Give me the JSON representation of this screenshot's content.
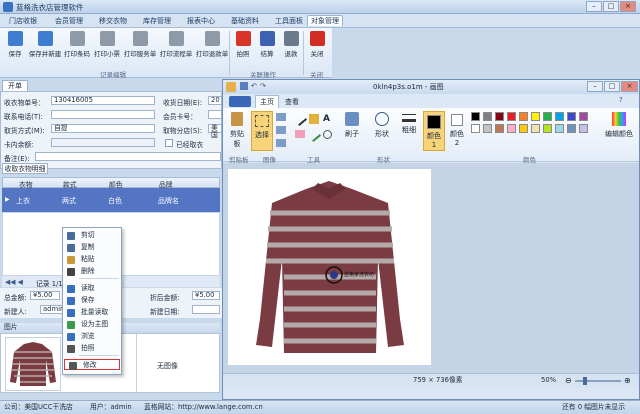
{
  "app": {
    "title": "蓝格洗衣店管理软件"
  },
  "menu": [
    "门店收银",
    "会员管理",
    "移交衣物",
    "库存管理",
    "报表中心",
    "基础资料",
    "工具面板",
    "对象管理"
  ],
  "ribbon": {
    "buttons": [
      {
        "label": "保存",
        "icon": "save-icon",
        "color": "#3f7dd0"
      },
      {
        "label": "保存并新建",
        "icon": "save-new-icon",
        "color": "#3f7dd0"
      },
      {
        "label": "打印条码",
        "icon": "printer-icon",
        "color": "#8e9aa8"
      },
      {
        "label": "打印小票",
        "icon": "printer-icon",
        "color": "#8e9aa8"
      },
      {
        "label": "打印服务单",
        "icon": "printer-icon",
        "color": "#8e9aa8"
      },
      {
        "label": "打印流程单",
        "icon": "printer-icon",
        "color": "#8e9aa8"
      },
      {
        "label": "打印退款单",
        "icon": "printer-icon",
        "color": "#8e9aa8"
      },
      {
        "label": "拍照",
        "icon": "eye-icon",
        "color": "#d8342a"
      },
      {
        "label": "结算",
        "icon": "tag-icon",
        "color": "#3c62b0"
      },
      {
        "label": "退款",
        "icon": "yen-icon",
        "color": "#6b7a8a"
      },
      {
        "label": "关闭",
        "icon": "close-icon",
        "color": "#d12d22"
      }
    ],
    "groups": [
      "记录编辑",
      "关联操作",
      "关闭"
    ]
  },
  "form": {
    "tab": "开单",
    "card_label": "收衣物单号：",
    "card_value": "130416005",
    "date_label": "收货日期(E):",
    "date_value": "20",
    "phone_label": "联系电话(T):",
    "member_label": "会员卡号：",
    "pickup_label": "取货方式(M):",
    "pickup_value": "自提",
    "store_label": "取物分店(S):",
    "store_value": "美国",
    "balance_label": "卡内余额:",
    "pickedup_label": "已经取衣",
    "note_label": "备注(E):"
  },
  "grid": {
    "tab": "收取衣物明细",
    "headers": [
      "衣物",
      "款式",
      "颜色",
      "品牌"
    ],
    "row": [
      "上衣",
      "两式",
      "白色",
      "品牌名"
    ],
    "nav": "记录 1/1"
  },
  "totals": {
    "total_label": "总金额:",
    "total_value": "¥5.00",
    "discount_label": "折后金额:",
    "discount_value": "¥5.00",
    "creator_label": "新建人:",
    "creator_value": "admin",
    "created_label": "新建日期:"
  },
  "pics": {
    "label": "图片",
    "no_image": "无图像"
  },
  "context_menu": [
    {
      "label": "剪切",
      "icon": "scissors-icon",
      "color": "#4a6c9b"
    },
    {
      "label": "复制",
      "icon": "copy-icon",
      "color": "#4a6c9b"
    },
    {
      "label": "粘贴",
      "icon": "paste-icon",
      "color": "#c79a3a"
    },
    {
      "label": "删除",
      "icon": "delete-icon",
      "color": "#444"
    },
    {
      "label": "读取",
      "icon": "open-icon",
      "color": "#3a6fbf"
    },
    {
      "label": "保存",
      "icon": "save-icon",
      "color": "#3a6fbf"
    },
    {
      "label": "批量读取",
      "icon": "batch-icon",
      "color": "#3a6fbf"
    },
    {
      "label": "设为主图",
      "icon": "image-icon",
      "color": "#3a9a4a"
    },
    {
      "label": "浏览",
      "icon": "browse-icon",
      "color": "#3a6fbf"
    },
    {
      "label": "拍照",
      "icon": "camera-icon",
      "color": "#555"
    },
    {
      "label": "修改",
      "icon": "edit-icon",
      "color": "#555"
    }
  ],
  "paint": {
    "title": "0kln4p3s.o1m - 画图",
    "tabs": [
      "主页",
      "查看"
    ],
    "groups": [
      "剪贴板",
      "图像",
      "工具",
      "形状",
      "颜色"
    ],
    "clipboard": "剪贴板",
    "select": "选择",
    "brush": "刷子",
    "shapes": "形状",
    "thickness": "粗细",
    "color1": "颜色 1",
    "color2": "颜色 2",
    "edit_colors": "编辑颜色",
    "size_text": "759 × 736像素",
    "zoom": "50%",
    "canvas_label": "蓝格家洗衣坊"
  },
  "palette": [
    "#000000",
    "#7f7f7f",
    "#880015",
    "#ed1c24",
    "#ff7f27",
    "#fff200",
    "#22b14c",
    "#00a2e8",
    "#3f48cc",
    "#a349a4",
    "#ffffff",
    "#c3c3c3",
    "#b97a57",
    "#ffaec9",
    "#ffc90e",
    "#efe4b0",
    "#b5e61d",
    "#99d9ea",
    "#7092be",
    "#c8bfe7"
  ],
  "status": {
    "shop": "公司：美国UCC干洗店",
    "user": "用户：admin",
    "site": "蓝格网站：http://www.lange.com.cn",
    "right": "还有 0 幅图片未显示"
  }
}
